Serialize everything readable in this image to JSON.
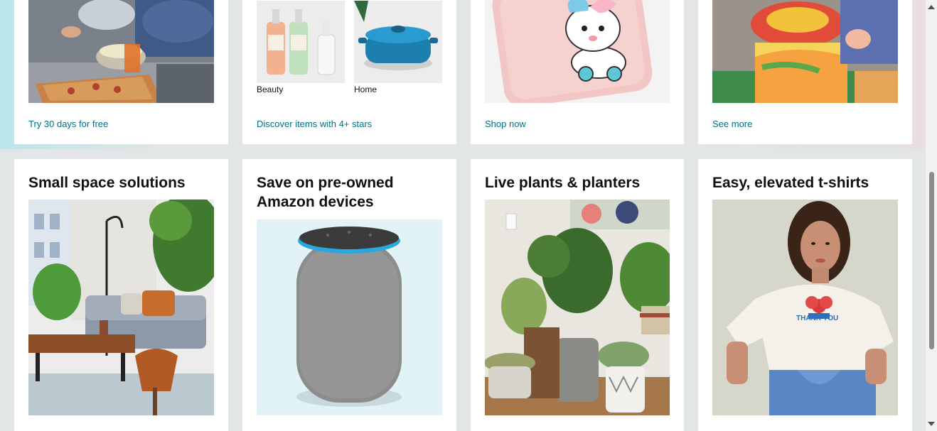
{
  "top_row": {
    "card1": {
      "link": "Try 30 days for free"
    },
    "card2": {
      "link": "Discover items with 4+ stars",
      "sub_items": [
        {
          "label": "Beauty"
        },
        {
          "label": "Home"
        }
      ]
    },
    "card3": {
      "link": "Shop now"
    },
    "card4": {
      "link": "See more"
    }
  },
  "bottom_row": {
    "card1": {
      "title": "Small space solutions"
    },
    "card2": {
      "title": "Save on pre-owned Amazon devices"
    },
    "card3": {
      "title": "Live plants & planters"
    },
    "card4": {
      "title": "Easy, elevated t-shirts",
      "shirt_text": "THANK YOU"
    }
  },
  "colors": {
    "link": "#007185",
    "title": "#0f1111",
    "page_bg": "#e3e6e6",
    "echo_ring": "#29a8e0"
  }
}
